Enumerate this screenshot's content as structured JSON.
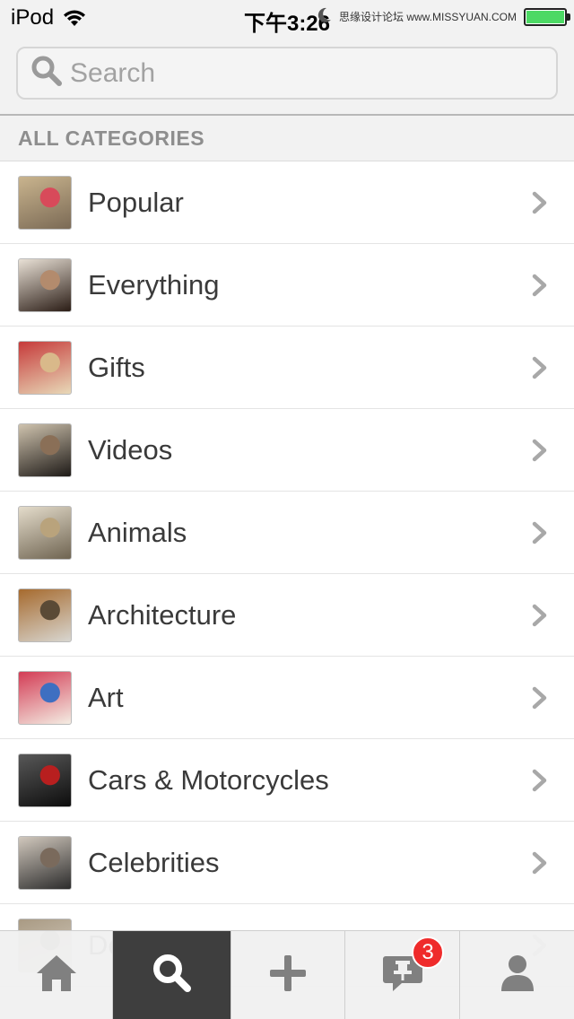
{
  "status_bar": {
    "device": "iPod",
    "time": "下午3:26",
    "watermark": "思缘设计论坛 www.MISSYUAN.COM",
    "battery_level": 0.95
  },
  "search": {
    "placeholder": "Search"
  },
  "section_header": "ALL CATEGORIES",
  "categories": [
    {
      "label": "Popular",
      "thumb_colors": [
        "#7b6a55",
        "#c9b48e",
        "#d84a5a"
      ]
    },
    {
      "label": "Everything",
      "thumb_colors": [
        "#2b1d16",
        "#e9e1d6",
        "#b38b6d"
      ]
    },
    {
      "label": "Gifts",
      "thumb_colors": [
        "#e8d9b8",
        "#c63a3a",
        "#d9b98a"
      ]
    },
    {
      "label": "Videos",
      "thumb_colors": [
        "#1e1a17",
        "#cfc3ae",
        "#8a6f57"
      ]
    },
    {
      "label": "Animals",
      "thumb_colors": [
        "#6f6451",
        "#e4dccb",
        "#b9a37c"
      ]
    },
    {
      "label": "Architecture",
      "thumb_colors": [
        "#d8d6d0",
        "#a66a2e",
        "#5a4a36"
      ]
    },
    {
      "label": "Art",
      "thumb_colors": [
        "#f4ede3",
        "#d33c55",
        "#3e6fc1"
      ]
    },
    {
      "label": "Cars & Motorcycles",
      "thumb_colors": [
        "#0d0d0d",
        "#585858",
        "#b81f1f"
      ]
    },
    {
      "label": "Celebrities",
      "thumb_colors": [
        "#2c2c2c",
        "#d1c8bd",
        "#7a6a5c"
      ]
    },
    {
      "label": "Design",
      "thumb_colors": [
        "#d6cfc4",
        "#a99a83",
        "#6f6150"
      ]
    }
  ],
  "tab_bar": {
    "tabs": [
      {
        "name": "home",
        "icon": "home-icon"
      },
      {
        "name": "search",
        "icon": "search-icon",
        "active": true
      },
      {
        "name": "add",
        "icon": "plus-icon"
      },
      {
        "name": "activity",
        "icon": "pin-comment-icon",
        "badge": "3"
      },
      {
        "name": "profile",
        "icon": "person-icon"
      }
    ]
  },
  "colors": {
    "active_tab": "#3e3e3e",
    "badge": "#ef2b2b",
    "text": "#3a3a3a",
    "section_text": "#8e8e8e"
  }
}
